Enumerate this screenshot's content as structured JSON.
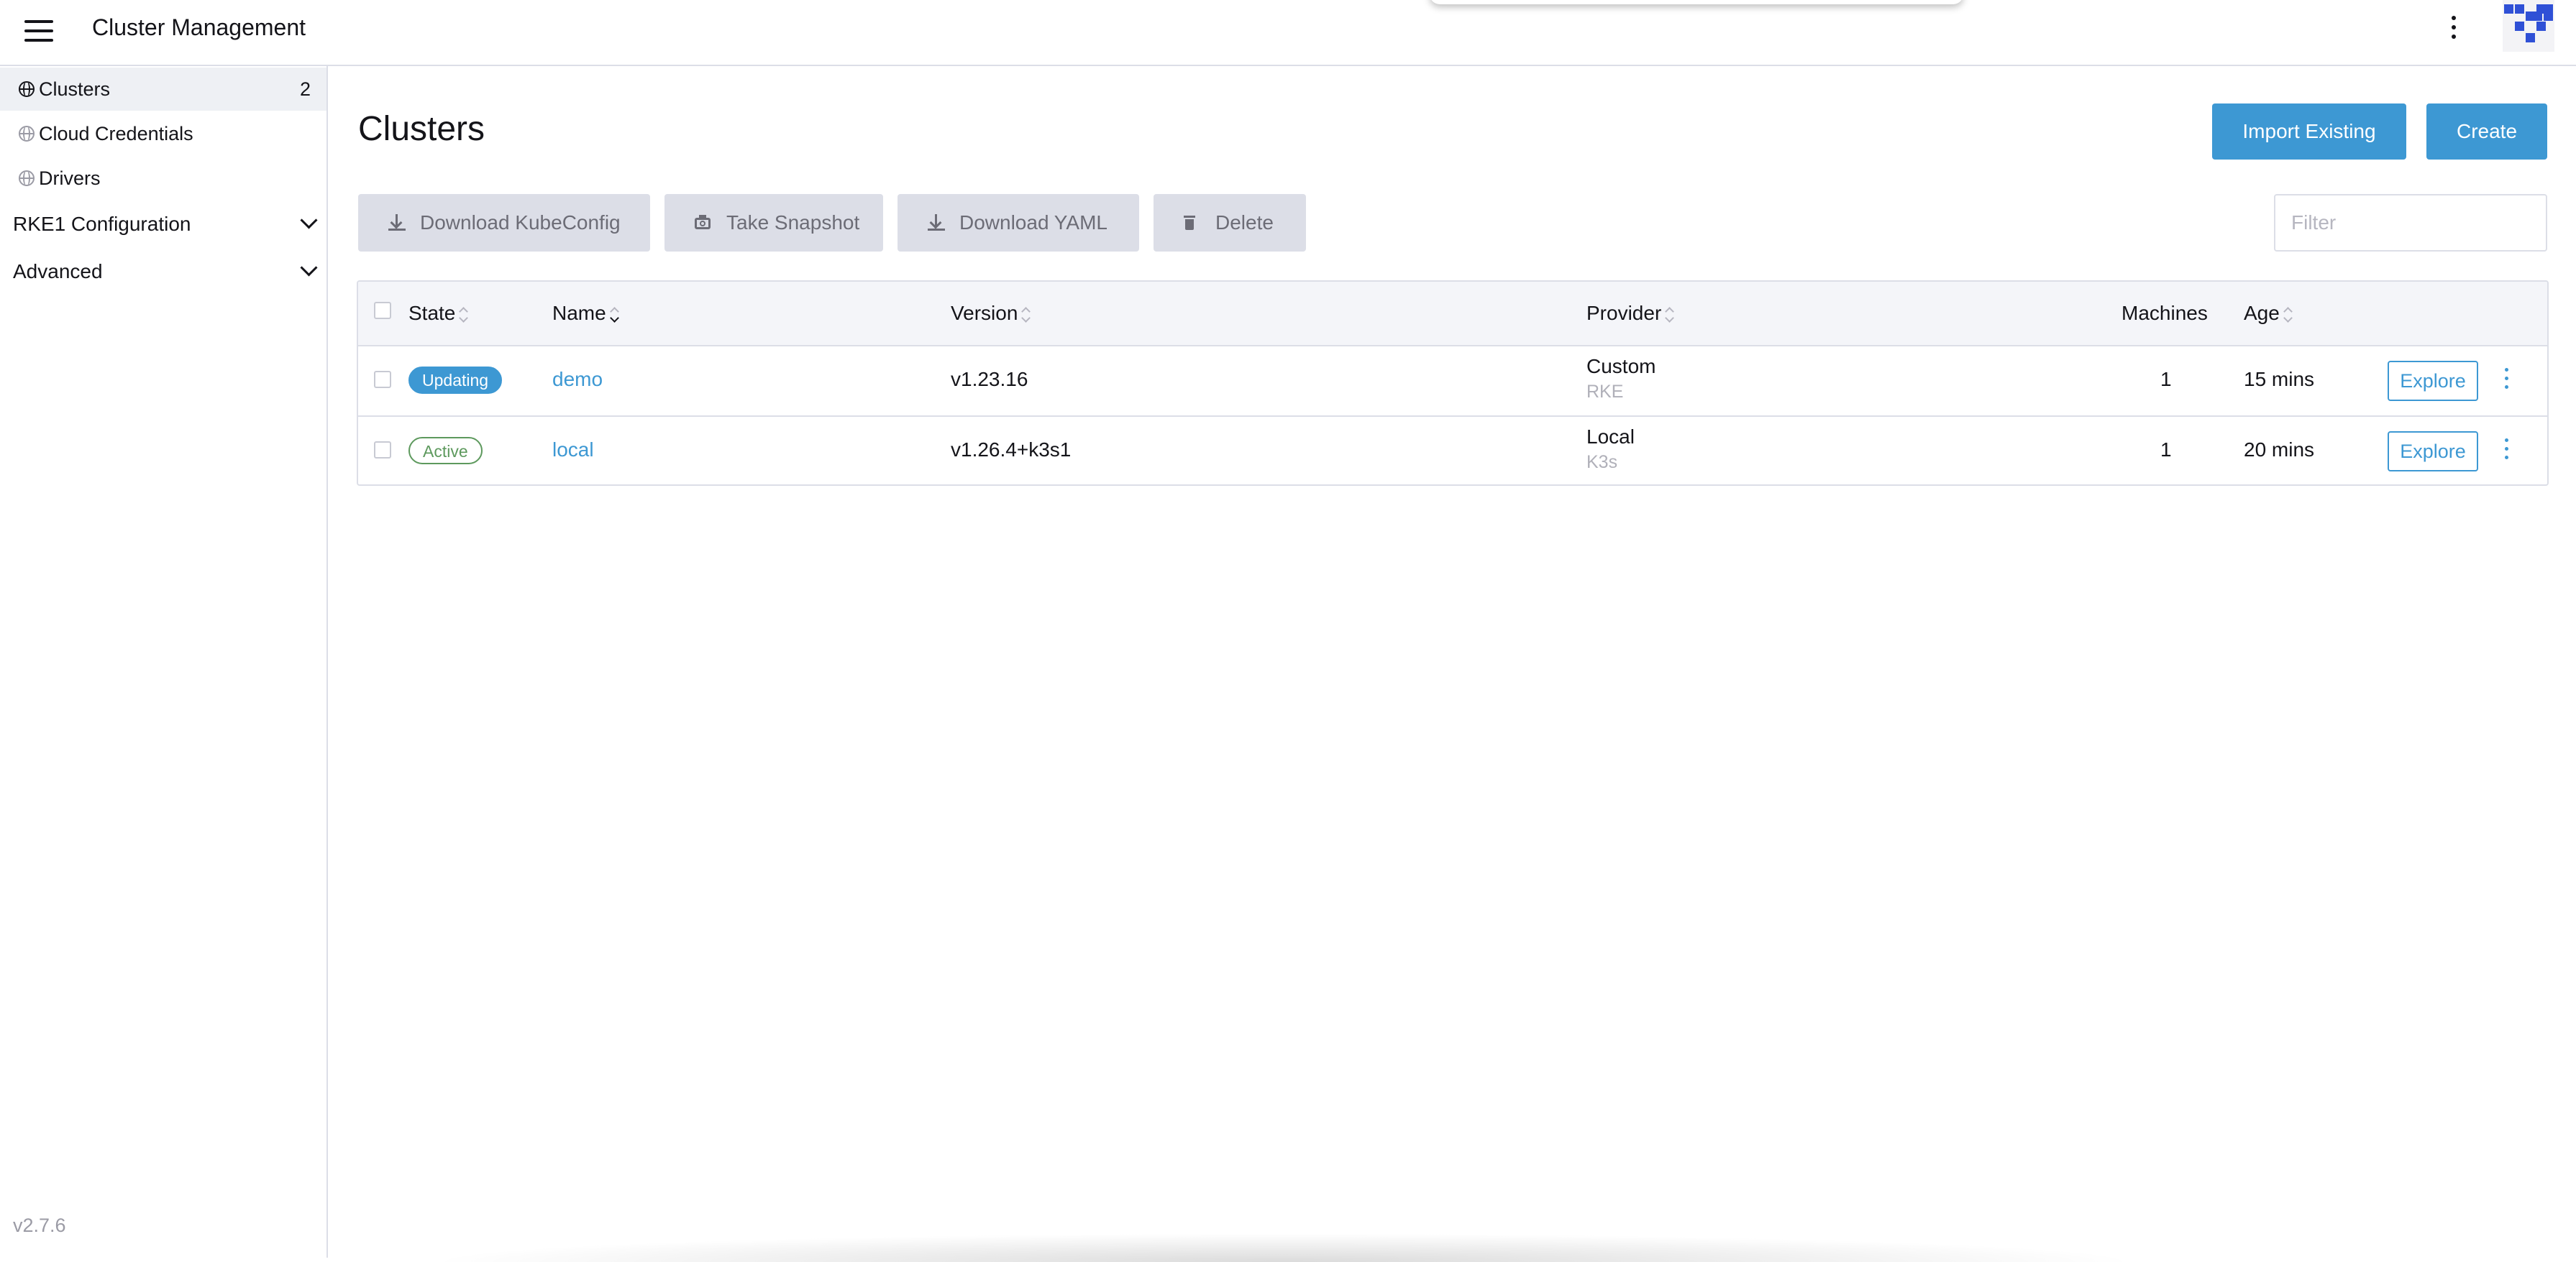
{
  "header": {
    "menu_icon": "hamburger-icon",
    "title": "Cluster Management",
    "more_icon": "vertical-dots-icon",
    "avatar_icon": "user-avatar-pixel-icon"
  },
  "sidebar": {
    "items": [
      {
        "label": "Clusters",
        "count": "2",
        "icon": "globe-icon",
        "active": true
      },
      {
        "label": "Cloud Credentials",
        "icon": "globe-icon"
      },
      {
        "label": "Drivers",
        "icon": "globe-icon"
      }
    ],
    "groups": [
      {
        "label": "RKE1 Configuration",
        "icon": "chevron-down-icon"
      },
      {
        "label": "Advanced",
        "icon": "chevron-down-icon"
      }
    ],
    "version": "v2.7.6"
  },
  "main": {
    "title": "Clusters",
    "actions": {
      "import_label": "Import Existing",
      "create_label": "Create"
    },
    "bulk_actions": {
      "download_kubeconfig": "Download KubeConfig",
      "take_snapshot": "Take Snapshot",
      "download_yaml": "Download YAML",
      "delete": "Delete"
    },
    "filter": {
      "placeholder": "Filter",
      "value": ""
    }
  },
  "table": {
    "columns": {
      "state": "State",
      "name": "Name",
      "version": "Version",
      "provider": "Provider",
      "machines": "Machines",
      "age": "Age"
    },
    "rows": [
      {
        "state": "Updating",
        "name": "demo",
        "version": "v1.23.16",
        "provider": "Custom",
        "provider_sub": "RKE",
        "machines": "1",
        "age": "15 mins",
        "action": "Explore"
      },
      {
        "state": "Active",
        "name": "local",
        "version": "v1.26.4+k3s1",
        "provider": "Local",
        "provider_sub": "K3s",
        "machines": "1",
        "age": "20 mins",
        "action": "Explore"
      }
    ]
  },
  "colors": {
    "accent": "#3d98d3",
    "active_state": "#5d995d",
    "bulk_button_bg": "#dcdee7"
  }
}
